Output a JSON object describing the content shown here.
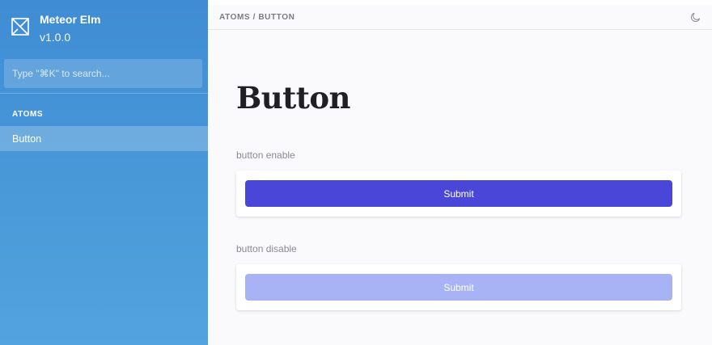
{
  "sidebar": {
    "brand": {
      "name": "Meteor Elm",
      "version": "v1.0.0",
      "icon": "logo-envelope-icon"
    },
    "search": {
      "placeholder": "Type \"⌘K\" to search...",
      "value": ""
    },
    "sections": [
      {
        "title": "ATOMS",
        "items": [
          {
            "label": "Button",
            "active": true
          }
        ]
      }
    ]
  },
  "topbar": {
    "breadcrumb": "ATOMS / BUTTON",
    "theme_icon": "moon-icon"
  },
  "main": {
    "title": "Button",
    "stories": [
      {
        "label": "button enable",
        "button_label": "Submit",
        "disabled": false
      },
      {
        "label": "button disable",
        "button_label": "Submit",
        "disabled": true
      }
    ]
  },
  "colors": {
    "sidebar_top": "#3f8cd4",
    "sidebar_bottom": "#52a3df",
    "button_enabled": "#4a47d8",
    "button_disabled": "#a8b3f5"
  }
}
